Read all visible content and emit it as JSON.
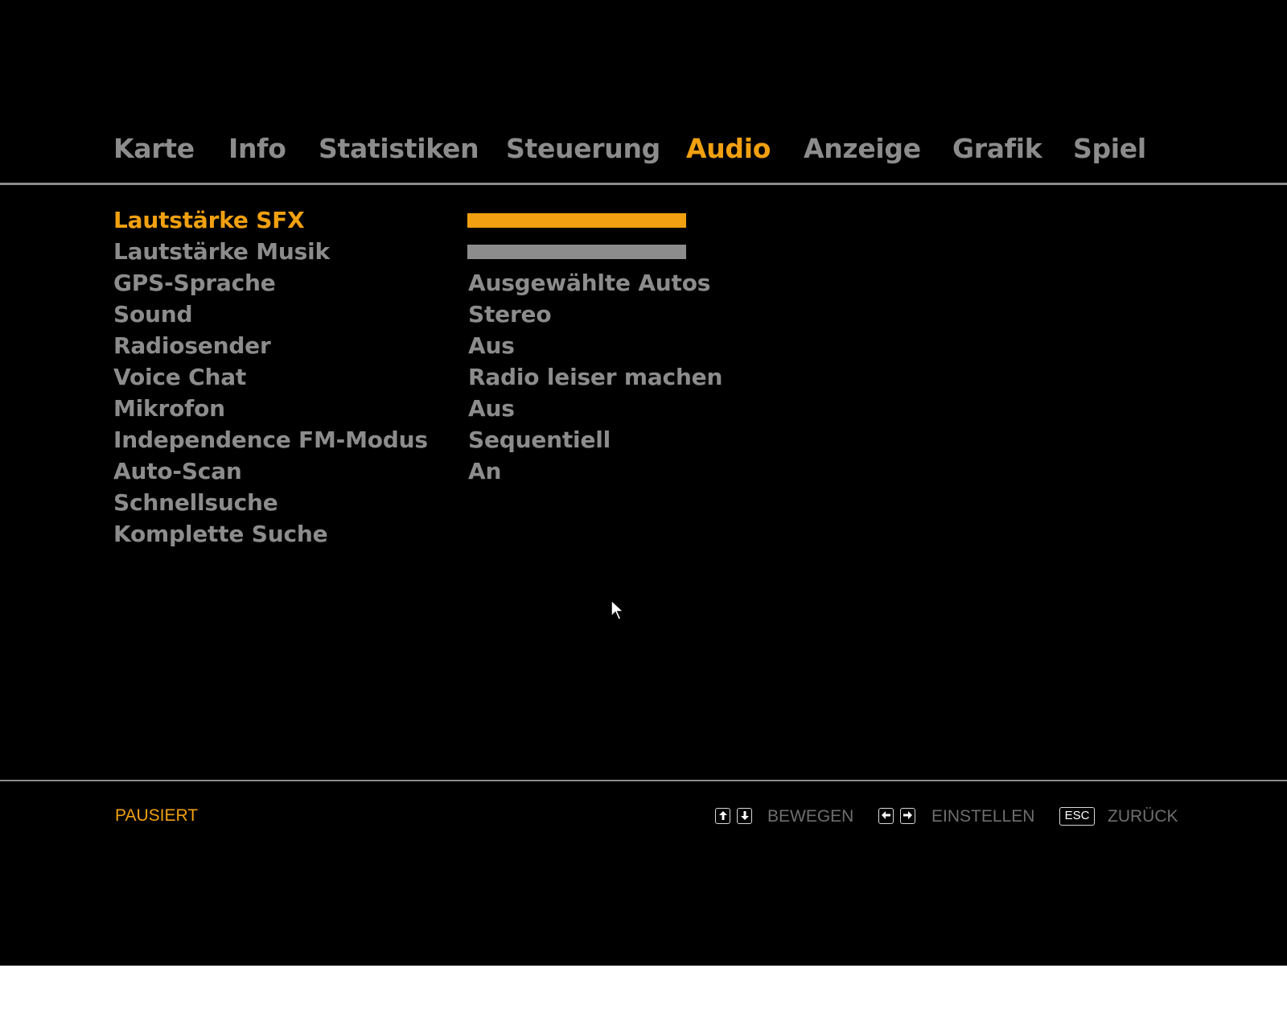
{
  "tabs": [
    {
      "label": "Karte",
      "active": false
    },
    {
      "label": "Info",
      "active": false
    },
    {
      "label": "Statistiken",
      "active": false
    },
    {
      "label": "Steuerung",
      "active": false
    },
    {
      "label": "Audio",
      "active": true
    },
    {
      "label": "Anzeige",
      "active": false
    },
    {
      "label": "Grafik",
      "active": false
    },
    {
      "label": "Spiel",
      "active": false
    }
  ],
  "settings": [
    {
      "label": "Lautstärke SFX",
      "value_type": "slider",
      "level": 1.0,
      "selected": true
    },
    {
      "label": "Lautstärke Musik",
      "value_type": "slider",
      "level": 1.0,
      "selected": false
    },
    {
      "label": "GPS-Sprache",
      "value": "Ausgewählte Autos"
    },
    {
      "label": "Sound",
      "value": "Stereo"
    },
    {
      "label": "Radiosender",
      "value": "Aus"
    },
    {
      "label": "Voice Chat",
      "value": "Radio leiser machen"
    },
    {
      "label": "Mikrofon",
      "value": "Aus"
    },
    {
      "label": "Independence FM-Modus",
      "value": "Sequentiell"
    },
    {
      "label": "Auto-Scan",
      "value": "An"
    },
    {
      "label": "Schnellsuche",
      "value": ""
    },
    {
      "label": "Komplette Suche",
      "value": ""
    }
  ],
  "footer": {
    "status": "PAUSIERT",
    "hints": {
      "move": "BEWEGEN",
      "adjust": "EINSTELLEN",
      "back_key": "ESC",
      "back": "ZURÜCK"
    },
    "icons": {
      "move": [
        "arrow-up-key-icon",
        "arrow-down-key-icon"
      ],
      "adjust": [
        "arrow-left-key-icon",
        "arrow-right-key-icon"
      ]
    }
  },
  "colors": {
    "accent": "#f0a010",
    "text": "#8c8c8c",
    "hint": "#6e6e6e",
    "background": "#000000"
  }
}
